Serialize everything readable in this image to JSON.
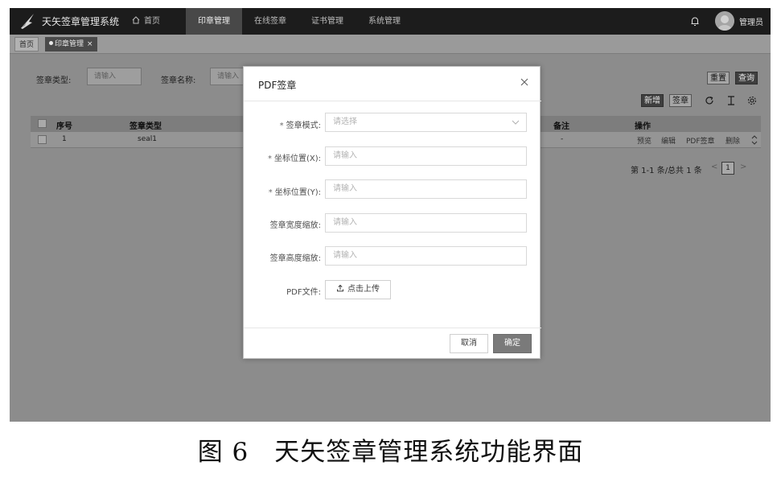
{
  "app": {
    "title": "天矢签章管理系统",
    "user_name": "管理员"
  },
  "nav": {
    "items": [
      {
        "label": "首页",
        "icon": "home-icon"
      },
      {
        "label": "印章管理"
      },
      {
        "label": "在线签章"
      },
      {
        "label": "证书管理"
      },
      {
        "label": "系统管理"
      }
    ],
    "active": "印章管理"
  },
  "tabs": {
    "home": "首页",
    "current": "印章管理",
    "close": "×"
  },
  "filters": {
    "type_label": "签章类型:",
    "type_placeholder": "请输入",
    "name_label": "签章名称:",
    "name_placeholder": "请输入"
  },
  "toolbar": {
    "reset": "重置",
    "search": "查询",
    "add": "新增",
    "sign": "签章",
    "icons": [
      "refresh-icon",
      "column-height-icon",
      "settings-icon"
    ]
  },
  "table": {
    "columns": {
      "index": "序号",
      "seal_type": "签章类型",
      "remark": "备注",
      "actions": "操作"
    },
    "rows": [
      {
        "index": "1",
        "seal_type": "seal1",
        "remark": "-",
        "actions": [
          "预览",
          "编辑",
          "PDF签章",
          "删除"
        ]
      }
    ]
  },
  "pagination": {
    "summary": "第 1-1 条/总共 1 条",
    "prev": "<",
    "current": "1",
    "next": ">"
  },
  "modal": {
    "title": "PDF签章",
    "close_icon": "close-icon",
    "fields": [
      {
        "label": "签章模式:",
        "required": true,
        "placeholder": "请选择",
        "type": "select"
      },
      {
        "label": "坐标位置(X):",
        "required": true,
        "placeholder": "请输入",
        "type": "input"
      },
      {
        "label": "坐标位置(Y):",
        "required": true,
        "placeholder": "请输入",
        "type": "input"
      },
      {
        "label": "签章宽度缩放:",
        "required": false,
        "placeholder": "请输入",
        "type": "input"
      },
      {
        "label": "签章高度缩放:",
        "required": false,
        "placeholder": "请输入",
        "type": "input"
      }
    ],
    "required_mark": "*",
    "file_label": "PDF文件:",
    "upload_label": "点击上传",
    "cancel": "取消",
    "ok": "确定"
  },
  "caption": "图 6　天矢签章管理系统功能界面"
}
